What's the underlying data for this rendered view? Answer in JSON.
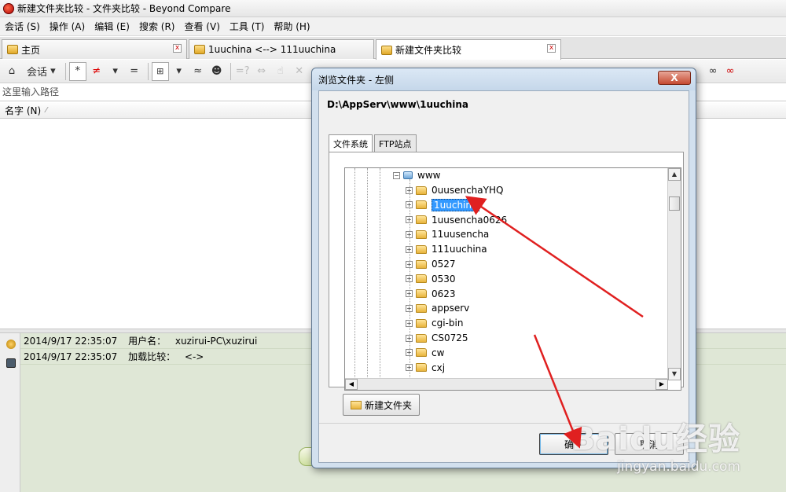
{
  "window": {
    "title": "新建文件夹比较 - 文件夹比较 - Beyond Compare"
  },
  "menu": [
    {
      "label": "会话 (S)"
    },
    {
      "label": "操作 (A)"
    },
    {
      "label": "编辑 (E)"
    },
    {
      "label": "搜索 (R)"
    },
    {
      "label": "查看 (V)"
    },
    {
      "label": "工具 (T)"
    },
    {
      "label": "帮助 (H)"
    }
  ],
  "tabs": [
    {
      "label": "主页"
    },
    {
      "label": "1uuchina <--> 111uuchina"
    },
    {
      "label": "新建文件夹比较"
    }
  ],
  "toolbar": {
    "session_label": "会话",
    "star": "*",
    "neq": "≠",
    "eq": "=",
    "approx": "≈"
  },
  "path": {
    "placeholder": "这里输入路径"
  },
  "columns": {
    "name_header": "名字 (N)"
  },
  "log": [
    {
      "time": "2014/9/17 22:35:07",
      "label": "用户名：",
      "value": "xuzirui-PC\\xuzirui"
    },
    {
      "time": "2014/9/17 22:35:07",
      "label": "加载比较：",
      "value": "<->"
    }
  ],
  "dialog": {
    "title": "浏览文件夹 - 左侧",
    "close": "X",
    "current_path": "D:\\AppServ\\www\\1uuchina",
    "tabs": [
      {
        "label": "文件系统"
      },
      {
        "label": "FTP站点"
      }
    ],
    "tree_root": {
      "label": "www"
    },
    "tree_items": [
      {
        "label": "0uusenchaYHQ",
        "selected": false
      },
      {
        "label": "1uuchina",
        "selected": true
      },
      {
        "label": "1uusencha0626",
        "selected": false
      },
      {
        "label": "11uusencha",
        "selected": false
      },
      {
        "label": "111uuchina",
        "selected": false
      },
      {
        "label": "0527",
        "selected": false
      },
      {
        "label": "0530",
        "selected": false
      },
      {
        "label": "0623",
        "selected": false
      },
      {
        "label": "appserv",
        "selected": false
      },
      {
        "label": "cgi-bin",
        "selected": false
      },
      {
        "label": "CS0725",
        "selected": false
      },
      {
        "label": "cw",
        "selected": false
      },
      {
        "label": "cxj",
        "selected": false
      }
    ],
    "new_folder_label": "新建文件夹",
    "ok_label": "确认",
    "cancel_label": "取消"
  },
  "watermark": {
    "logo": "Baidu经验",
    "url": "jingyan.baidu.com"
  },
  "badge": {
    "label": "中☽简▦"
  },
  "colors": {
    "selection": "#3399ff",
    "arrow": "#e02020",
    "log_bg": "#dfe7d6",
    "dialog_frame": "#d2e0ee"
  }
}
